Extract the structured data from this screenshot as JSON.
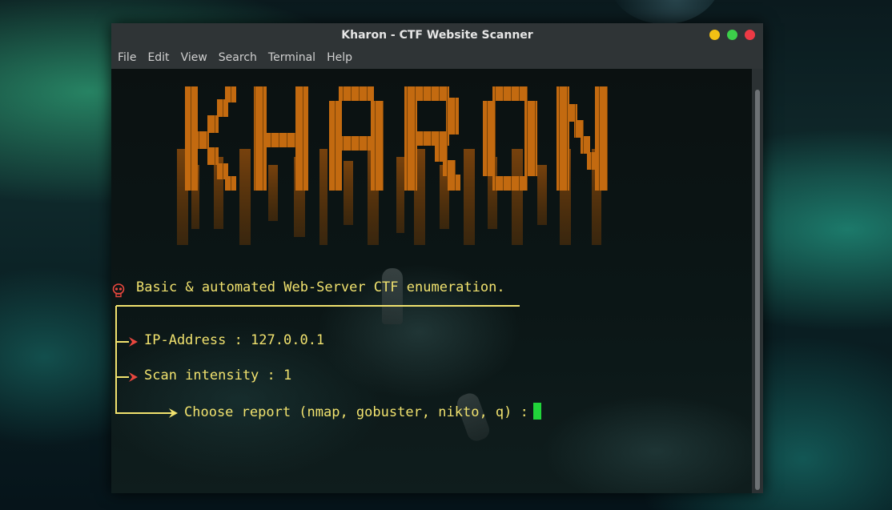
{
  "window": {
    "title": "Kharon - CTF Website Scanner"
  },
  "menu": [
    "File",
    "Edit",
    "View",
    "Search",
    "Terminal",
    "Help"
  ],
  "terminal": {
    "banner_text": "KHARON",
    "tagline": "Basic & automated Web-Server CTF enumeration.",
    "ip_line": "IP-Address : 127.0.0.1",
    "intensity_line": "Scan intensity : 1",
    "prompt_line": "Choose report (nmap, gobuster, nikto, q) :",
    "cursor_color": "#21d43a",
    "text_color": "#f1e26e",
    "arrow_color": "#e8473e",
    "banner_color": "#c36a10"
  }
}
